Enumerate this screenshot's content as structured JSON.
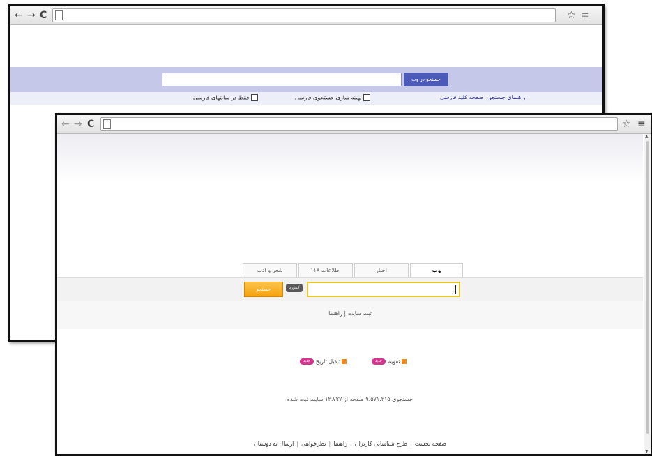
{
  "back_window": {
    "search_button_label": "جستجو در وب",
    "option_1_label": "بهینه سازی جستجوی فارسی",
    "option_2_label": "فقط در سایتهای فارسی",
    "links": [
      "راهنمای جستجو",
      "صفحه کلید فارسی"
    ]
  },
  "front_window": {
    "tabs": [
      "وب",
      "اخبار",
      "اطلاعات ۱۱۸",
      "شعر و ادب"
    ],
    "search_button_label": "جستجو",
    "keyboard_label": "کیبورد",
    "register_links": "ثبت سایت | راهنما",
    "tools": [
      {
        "label": "تقویم",
        "badge": "جدید"
      },
      {
        "label": "تبدیل تاریخ",
        "badge": "جدید"
      }
    ],
    "stats": "جستجوی ۹،۵۷۱،۲۱۵ صفحه از ۱۲،۷۲۷ سایت ثبت شده",
    "footer_links": [
      "صفحه نخست",
      "طرح شناسایی کاربران",
      "راهنما",
      "نظرخواهی",
      "ارسال به دوستان"
    ]
  },
  "icons": {
    "back": "back-arrow-icon",
    "forward": "forward-arrow-icon",
    "reload": "reload-icon",
    "page": "page-icon",
    "star": "star-icon",
    "menu": "menu-icon"
  },
  "colors": {
    "back_search_band": "#c6c8ea",
    "back_search_button": "#4b59b9",
    "front_search_button": "#f5a20d",
    "front_input_border": "#e8c82c",
    "badge": "#d4368f"
  }
}
